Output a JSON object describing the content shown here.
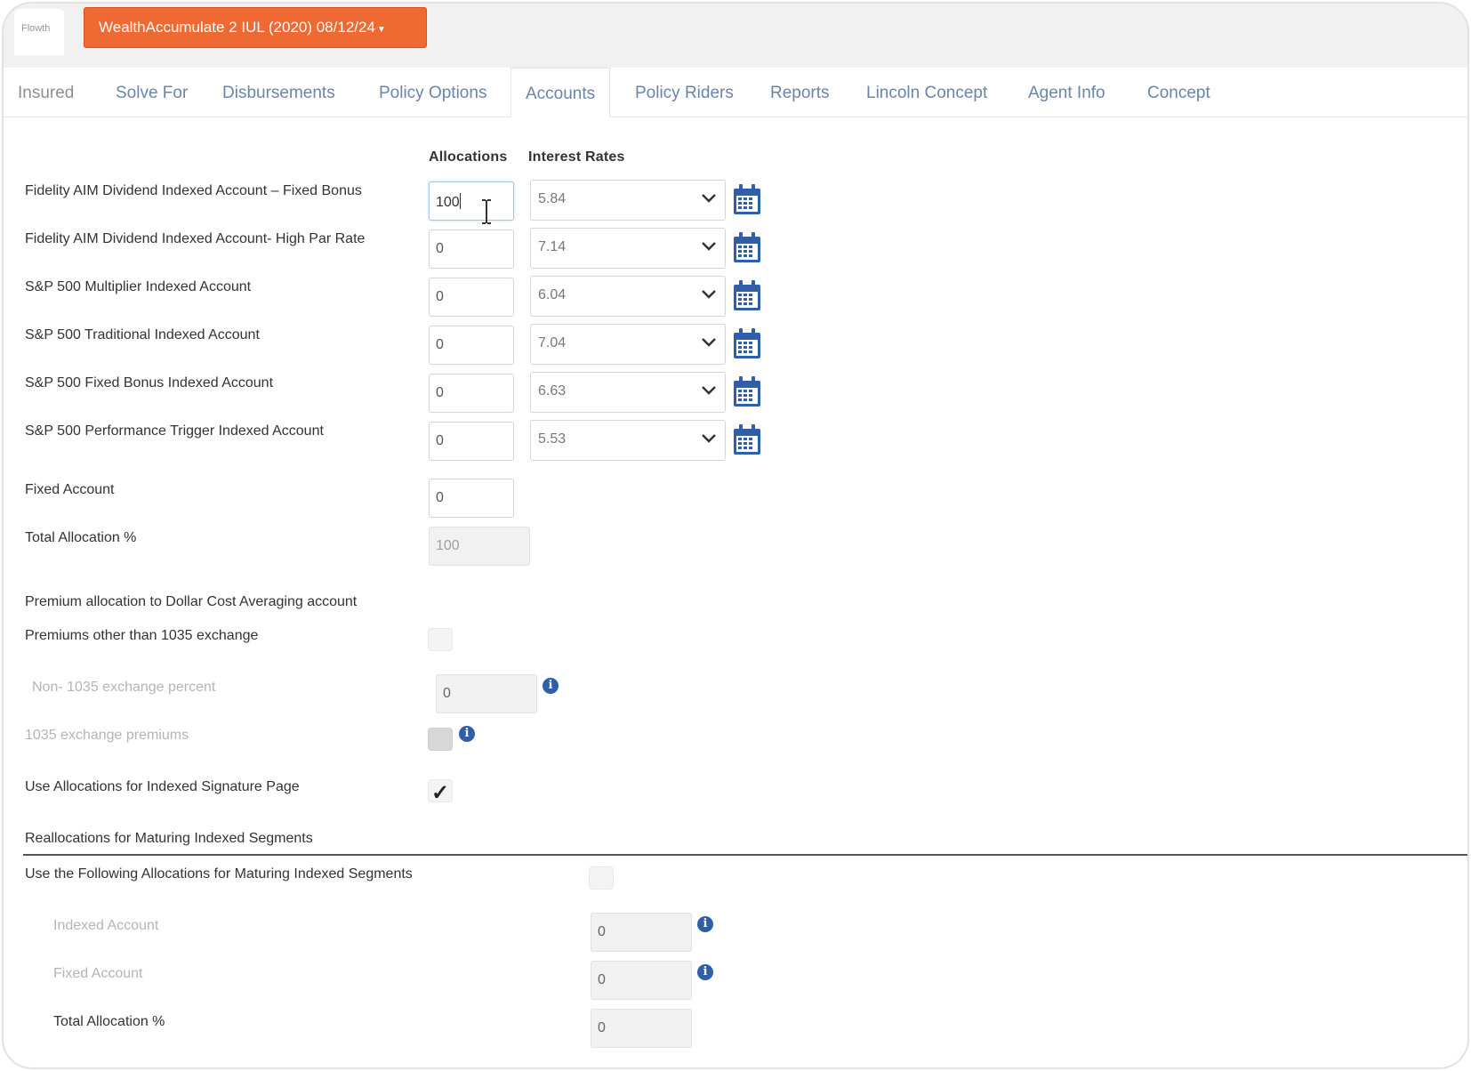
{
  "header": {
    "logo_text": "Flowth",
    "product_selector": "WealthAccumulate 2 IUL (2020) 08/12/24"
  },
  "tabs": [
    {
      "label": "Insured"
    },
    {
      "label": "Solve For"
    },
    {
      "label": "Disbursements"
    },
    {
      "label": "Policy Options"
    },
    {
      "label": "Accounts",
      "active": true
    },
    {
      "label": "Policy Riders"
    },
    {
      "label": "Reports"
    },
    {
      "label": "Lincoln Concept"
    },
    {
      "label": "Agent Info"
    },
    {
      "label": "Concept"
    }
  ],
  "accounts": {
    "column_allocations": "Allocations",
    "column_interest_rates": "Interest Rates",
    "rows": [
      {
        "label": "Fidelity AIM Dividend Indexed Account – Fixed Bonus",
        "allocation": "100",
        "rate": "5.84"
      },
      {
        "label": "Fidelity AIM Dividend Indexed Account- High Par Rate",
        "allocation": "0",
        "rate": "7.14"
      },
      {
        "label": "S&P 500 Multiplier Indexed Account",
        "allocation": "0",
        "rate": "6.04"
      },
      {
        "label": "S&P 500 Traditional Indexed Account",
        "allocation": "0",
        "rate": "7.04"
      },
      {
        "label": "S&P 500 Fixed Bonus Indexed Account",
        "allocation": "0",
        "rate": "6.63"
      },
      {
        "label": "S&P 500 Performance Trigger Indexed Account",
        "allocation": "0",
        "rate": "5.53"
      }
    ],
    "fixed_account": {
      "label": "Fixed Account",
      "value": "0"
    },
    "total": {
      "label": "Total Allocation %",
      "value": "100"
    }
  },
  "dca": {
    "heading": "Premium allocation to Dollar Cost Averaging account",
    "premiums_other_label": "Premiums other than 1035 exchange",
    "premiums_other_checked": false,
    "non1035_label": "Non- 1035 exchange percent",
    "non1035_value": "0",
    "exchange_label": "1035 exchange premiums",
    "exchange_checked": false
  },
  "signature": {
    "label": "Use Allocations for Indexed Signature Page",
    "checked": true,
    "tick": "✓"
  },
  "reallocations": {
    "heading": "Reallocations for Maturing Indexed Segments",
    "use_following_label": "Use the Following Allocations for Maturing Indexed Segments",
    "use_following_checked": false,
    "indexed_label": "Indexed Account",
    "indexed_value": "0",
    "fixed_label": "Fixed Account",
    "fixed_value": "0",
    "total_label": "Total Allocation %",
    "total_value": "0"
  },
  "info_glyph": "i",
  "colors": {
    "accent_orange": "#ee6a32",
    "tab_link": "#6b85a8",
    "icon_blue": "#2f5fa8"
  }
}
